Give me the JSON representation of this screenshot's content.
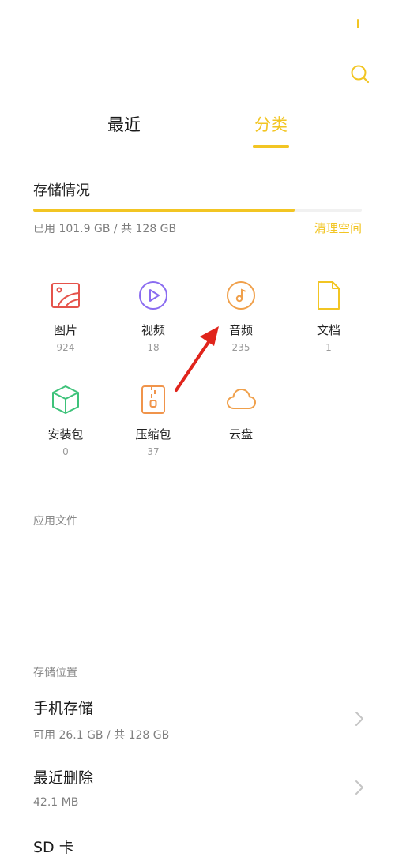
{
  "tabs": {
    "recent": "最近",
    "category": "分类"
  },
  "storage": {
    "title": "存储情况",
    "used_text": "已用 101.9 GB / 共 128 GB",
    "used_fraction": 0.796,
    "clean_label": "清理空间"
  },
  "categories": [
    {
      "label": "图片",
      "count": "924",
      "icon": "image-icon",
      "color": "#e5534b"
    },
    {
      "label": "视频",
      "count": "18",
      "icon": "video-play-icon",
      "color": "#8a6cf0"
    },
    {
      "label": "音频",
      "count": "235",
      "icon": "music-note-icon",
      "color": "#f0a04b"
    },
    {
      "label": "文档",
      "count": "1",
      "icon": "document-icon",
      "color": "#f2c523"
    },
    {
      "label": "安装包",
      "count": "0",
      "icon": "package-cube-icon",
      "color": "#3ec27a"
    },
    {
      "label": "压缩包",
      "count": "37",
      "icon": "zip-archive-icon",
      "color": "#f0944b"
    },
    {
      "label": "云盘",
      "count": "",
      "icon": "cloud-icon",
      "color": "#f0a04b"
    }
  ],
  "app_files": {
    "label": "应用文件"
  },
  "locations": {
    "label": "存储位置",
    "phone": {
      "title": "手机存储",
      "subtitle": "可用 26.1 GB / 共 128 GB"
    },
    "trash": {
      "title": "最近删除",
      "subtitle": "42.1 MB"
    },
    "sd": {
      "title": "SD 卡"
    }
  },
  "colors": {
    "accent": "#f2c523",
    "annotation_arrow": "#e0241b"
  }
}
